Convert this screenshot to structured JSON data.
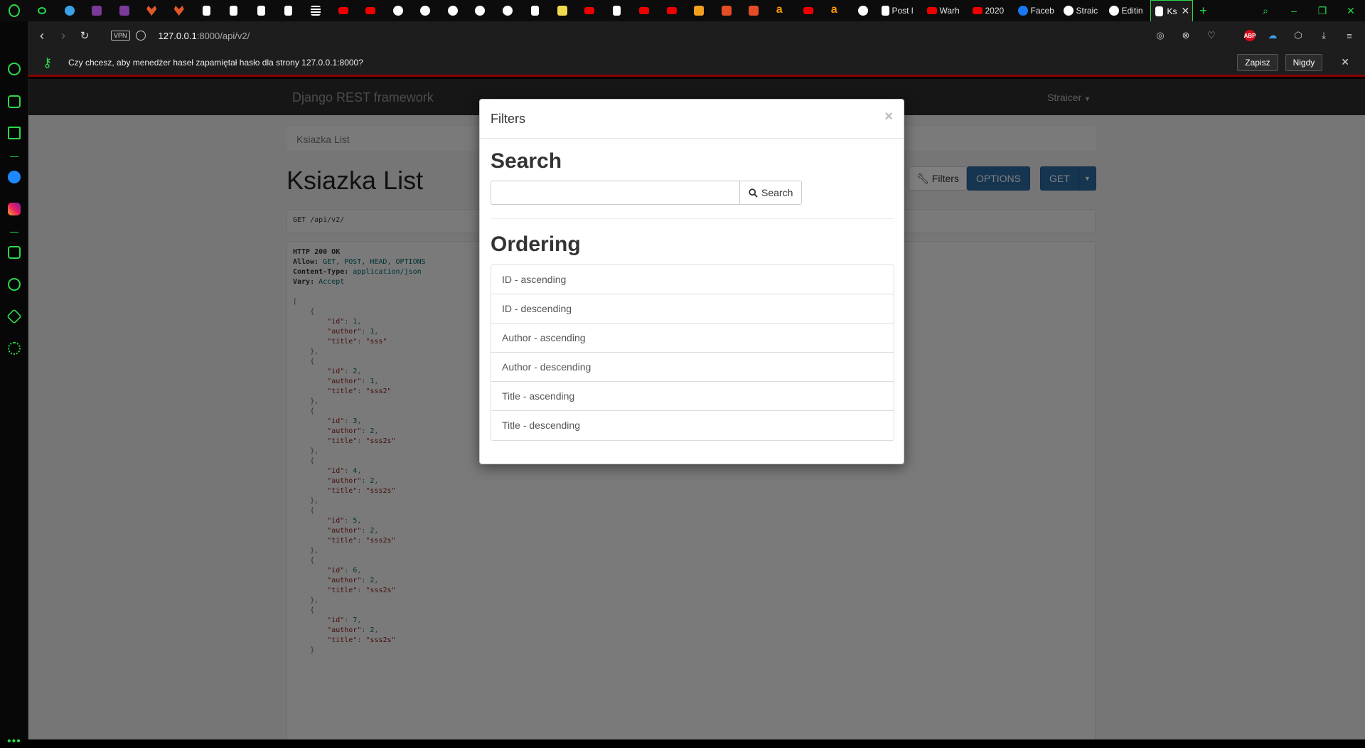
{
  "browser": {
    "active_tab_label": "Ks",
    "tabs": [
      {
        "label": "Post l",
        "icon": "doc-icon"
      },
      {
        "label": "Warh",
        "icon": "youtube-icon"
      },
      {
        "label": "2020",
        "icon": "youtube-icon"
      },
      {
        "label": "Faceb",
        "icon": "facebook-icon"
      },
      {
        "label": "Straic",
        "icon": "github-icon"
      },
      {
        "label": "Editin",
        "icon": "github-icon"
      }
    ],
    "url_host": "127.0.0.1",
    "url_path": ":8000/api/v2/",
    "vpn_label": "VPN",
    "abp_label": "ABP"
  },
  "password_bar": {
    "message": "Czy chcesz, aby menedżer haseł zapamiętał hasło dla strony 127.0.0.1:8000?",
    "save_label": "Zapisz",
    "never_label": "Nigdy"
  },
  "drf": {
    "brand": "Django REST framework",
    "user": "Straicer",
    "breadcrumb": "Ksiazka List",
    "title": "Ksiazka List",
    "filters_label": "Filters",
    "options_label": "OPTIONS",
    "get_label": "GET",
    "request_line": "GET /api/v2/",
    "response_headers": [
      {
        "key": "HTTP 200 OK",
        "value": ""
      },
      {
        "key": "Allow:",
        "value": "GET, POST, HEAD, OPTIONS"
      },
      {
        "key": "Content-Type:",
        "value": "application/json"
      },
      {
        "key": "Vary:",
        "value": "Accept"
      }
    ],
    "items": [
      {
        "id": 1,
        "author": 1,
        "title": "sss"
      },
      {
        "id": 2,
        "author": 1,
        "title": "sss2"
      },
      {
        "id": 3,
        "author": 2,
        "title": "sss2s"
      },
      {
        "id": 4,
        "author": 2,
        "title": "sss2s"
      },
      {
        "id": 5,
        "author": 2,
        "title": "sss2s"
      },
      {
        "id": 6,
        "author": 2,
        "title": "sss2s"
      },
      {
        "id": 7,
        "author": 2,
        "title": "sss2s"
      }
    ]
  },
  "modal": {
    "title": "Filters",
    "close_glyph": "×",
    "search_heading": "Search",
    "search_value": "",
    "search_button": "Search",
    "ordering_heading": "Ordering",
    "ordering": [
      "ID - ascending",
      "ID - descending",
      "Author - ascending",
      "Author - descending",
      "Title - ascending",
      "Title - descending"
    ]
  },
  "colors": {
    "accent": "#2bd94b",
    "primary_button": "#2c6aa0",
    "navbar": "#2c2c2c"
  }
}
